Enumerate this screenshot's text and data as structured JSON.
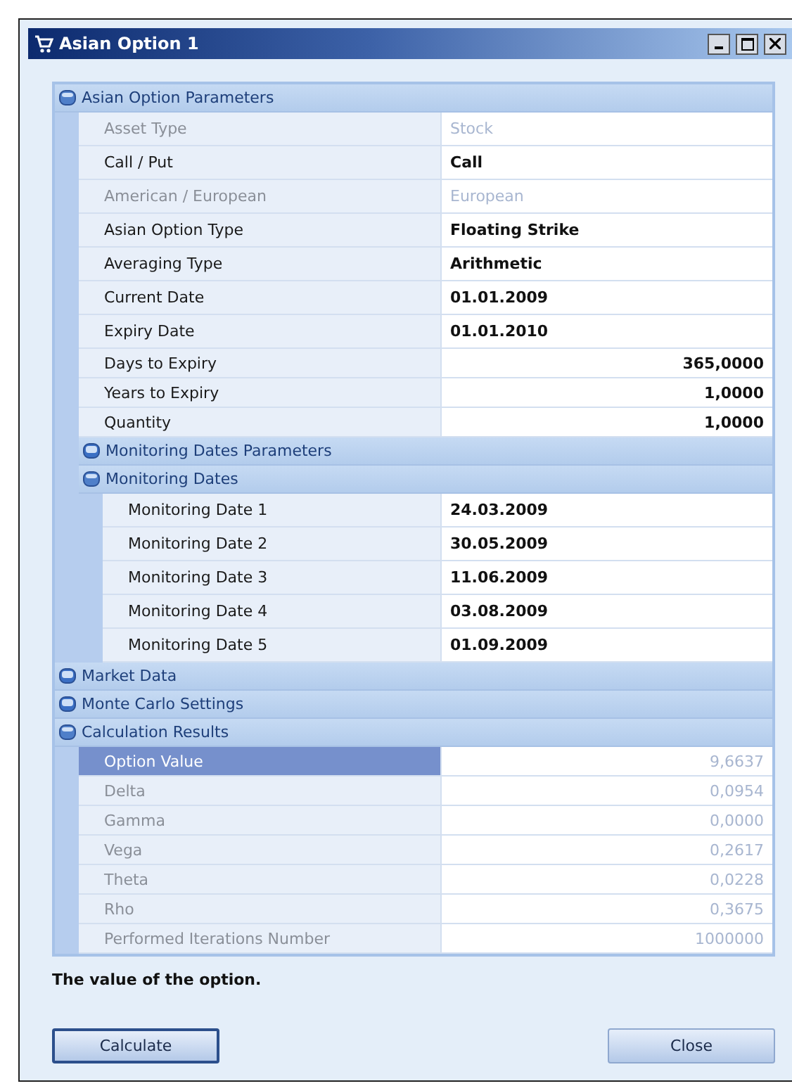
{
  "window": {
    "title": "Asian Option 1"
  },
  "sections": [
    {
      "title": "Asian Option Parameters",
      "expanded": true,
      "rows": [
        {
          "label": "Asset Type",
          "value": "Stock",
          "disabled": true,
          "numeric": false,
          "selected": false
        },
        {
          "label": "Call / Put",
          "value": "Call",
          "disabled": false,
          "numeric": false,
          "selected": false
        },
        {
          "label": "American / European",
          "value": "European",
          "disabled": true,
          "numeric": false,
          "selected": false
        },
        {
          "label": "Asian Option Type",
          "value": "Floating Strike",
          "disabled": false,
          "numeric": false,
          "selected": false
        },
        {
          "label": "Averaging Type",
          "value": "Arithmetic",
          "disabled": false,
          "numeric": false,
          "selected": false
        },
        {
          "label": "Current Date",
          "value": "01.01.2009",
          "disabled": false,
          "numeric": false,
          "selected": false
        },
        {
          "label": "Expiry Date",
          "value": "01.01.2010",
          "disabled": false,
          "numeric": false,
          "selected": false
        },
        {
          "label": "Days to Expiry",
          "value": "365,0000",
          "disabled": false,
          "numeric": true,
          "selected": false
        },
        {
          "label": "Years to Expiry",
          "value": "1,0000",
          "disabled": false,
          "numeric": true,
          "selected": false
        },
        {
          "label": "Quantity",
          "value": "1,0000",
          "disabled": false,
          "numeric": true,
          "selected": false
        }
      ],
      "children": [
        {
          "title": "Monitoring Dates Parameters",
          "expanded": false
        },
        {
          "title": "Monitoring Dates",
          "expanded": true,
          "rows": [
            {
              "label": "Monitoring Date 1",
              "value": "24.03.2009",
              "disabled": false,
              "numeric": false,
              "selected": false
            },
            {
              "label": "Monitoring Date 2",
              "value": "30.05.2009",
              "disabled": false,
              "numeric": false,
              "selected": false
            },
            {
              "label": "Monitoring Date 3",
              "value": "11.06.2009",
              "disabled": false,
              "numeric": false,
              "selected": false
            },
            {
              "label": "Monitoring Date 4",
              "value": "03.08.2009",
              "disabled": false,
              "numeric": false,
              "selected": false
            },
            {
              "label": "Monitoring Date 5",
              "value": "01.09.2009",
              "disabled": false,
              "numeric": false,
              "selected": false
            }
          ]
        }
      ]
    },
    {
      "title": "Market Data",
      "expanded": false
    },
    {
      "title": "Monte Carlo Settings",
      "expanded": false
    },
    {
      "title": "Calculation Results",
      "expanded": true,
      "rows": [
        {
          "label": "Option Value",
          "value": "9,6637",
          "disabled": true,
          "numeric": true,
          "selected": true
        },
        {
          "label": "Delta",
          "value": "0,0954",
          "disabled": true,
          "numeric": true,
          "selected": false
        },
        {
          "label": "Gamma",
          "value": "0,0000",
          "disabled": true,
          "numeric": true,
          "selected": false
        },
        {
          "label": "Vega",
          "value": "0,2617",
          "disabled": true,
          "numeric": true,
          "selected": false
        },
        {
          "label": "Theta",
          "value": "0,0228",
          "disabled": true,
          "numeric": true,
          "selected": false
        },
        {
          "label": "Rho",
          "value": "0,3675",
          "disabled": true,
          "numeric": true,
          "selected": false
        },
        {
          "label": "Performed Iterations Number",
          "value": "1000000",
          "disabled": true,
          "numeric": true,
          "selected": false
        }
      ]
    }
  ],
  "description": "The value of the option.",
  "buttons": [
    {
      "label": "Calculate",
      "default": true
    },
    {
      "label": "Close",
      "default": false
    }
  ]
}
